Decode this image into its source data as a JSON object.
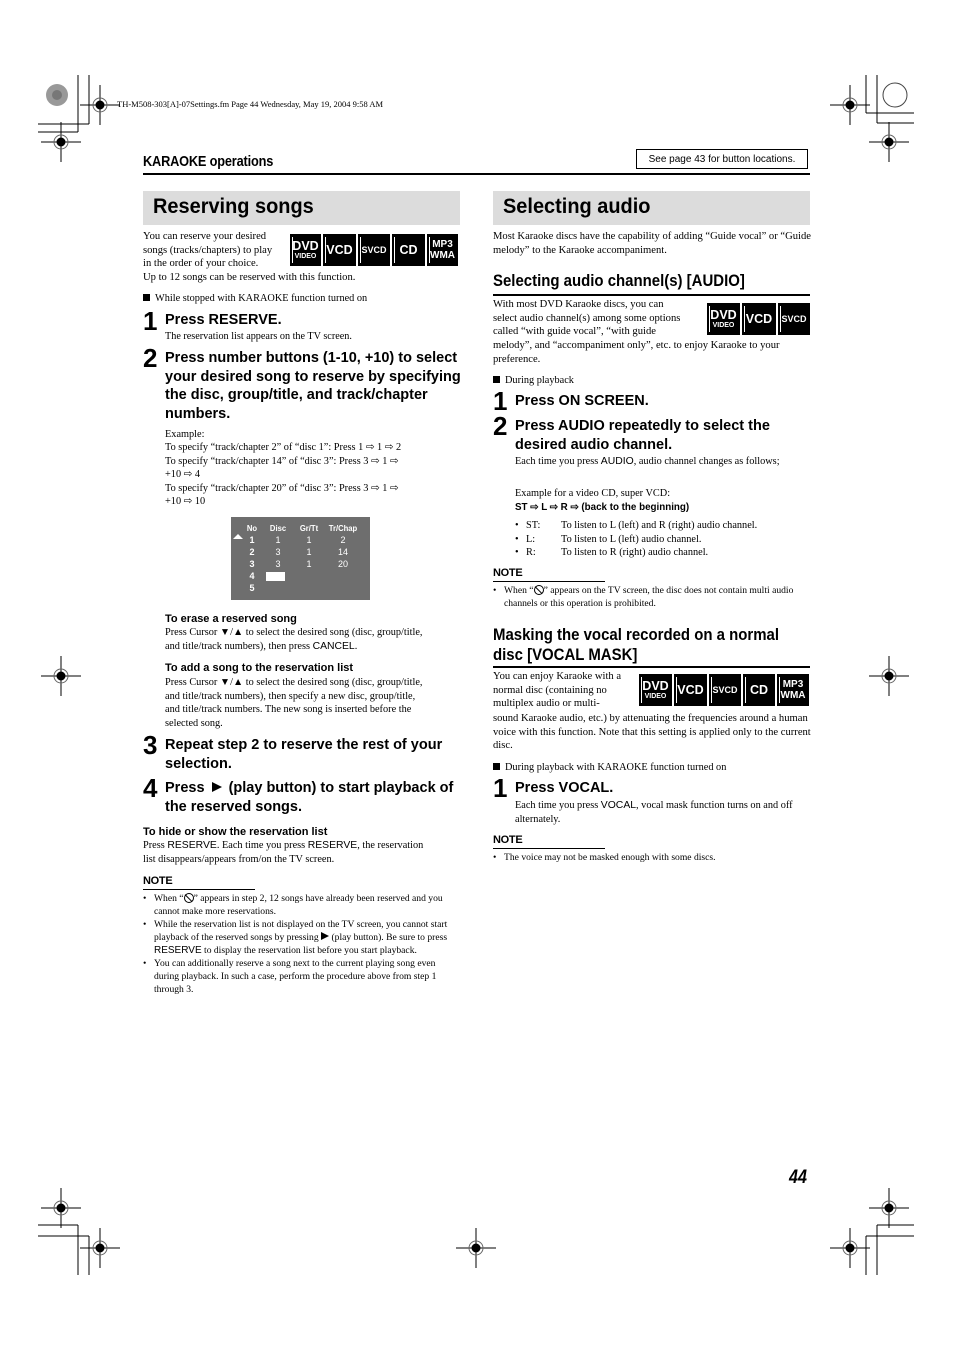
{
  "file_info": "TH-M508-303[A]-07Settings.fm  Page 44  Wednesday, May 19, 2004  9:58 AM",
  "header": {
    "section_label": "KARAOKE operations",
    "see_page_note": "See page 43 for button locations."
  },
  "page_number": "44",
  "left": {
    "title": "Reserving songs",
    "intro_lines": [
      "You can reserve your desired",
      "songs (tracks/chapters) to play",
      "in the order of your choice."
    ],
    "intro_tail": "Up to 12 songs can be reserved with this function.",
    "badges": [
      {
        "line1": "DVD",
        "line2": "VIDEO",
        "icon": "dvd-video-icon"
      },
      {
        "line1": "VCD",
        "icon": "vcd-icon"
      },
      {
        "line1": "SVCD",
        "icon": "svcd-icon"
      },
      {
        "line1": "CD",
        "icon": "cd-icon"
      },
      {
        "line1": "MP3",
        "line2": "WMA",
        "icon": "mp3-wma-icon"
      }
    ],
    "condition": "While stopped with KARAOKE function turned on",
    "steps": [
      {
        "num": "1",
        "text": "Press RESERVE.",
        "desc": "The reservation list appears on the TV screen."
      },
      {
        "num": "2",
        "text": "Press number buttons (1-10, +10) to select your desired song to reserve by specifying the disc, group/title, and track/chapter numbers."
      },
      {
        "num": "3",
        "text": "Repeat step 2 to reserve the rest of your selection."
      },
      {
        "num": "4",
        "text_before": "Press",
        "text_after": "(play button) to start playback of the reserved songs."
      }
    ],
    "example": {
      "label": "Example:",
      "lines": [
        "To specify “track/chapter 2” of “disc 1”: Press 1 ⇨ 1 ⇨ 2",
        "To specify “track/chapter 14” of “disc 3”: Press 3 ⇨ 1 ⇨",
        "+10 ⇨ 4",
        "To specify “track/chapter 20” of “disc 3”: Press 3 ⇨ 1 ⇨",
        "+10 ⇨ 10"
      ]
    },
    "reservation_screen": {
      "columns": [
        "No",
        "Disc",
        "Gr/Tt",
        "Tr/Chap"
      ],
      "rows": [
        [
          "1",
          "1",
          "1",
          "2"
        ],
        [
          "2",
          "3",
          "1",
          "14"
        ],
        [
          "3",
          "3",
          "1",
          "20"
        ],
        [
          "4",
          "",
          "",
          ""
        ],
        [
          "5",
          "",
          "",
          ""
        ]
      ]
    },
    "erase": {
      "title": "To erase a reserved song",
      "text_lines": [
        "Press Cursor ▼/▲ to select the desired song (disc, group/title,",
        "and title/track numbers), then press"
      ],
      "key": "CANCEL",
      "end": "."
    },
    "add": {
      "title": "To add a song to the reservation list",
      "text_lines": [
        "Press Cursor ▼/▲ to select the desired song (disc, group/title,",
        "and title/track numbers), then specify a new disc, group/title,",
        "and title/track numbers. The new song is inserted before the",
        "selected song."
      ]
    },
    "hide_show": {
      "title": "To hide or show the reservation list",
      "line1_a": "Press ",
      "key": "RESERVE",
      "line1_b": ". Each time you press ",
      "line1_c": ", the reservation",
      "line2": "list disappears/appears from/on the TV screen."
    },
    "note": {
      "title": "NOTE",
      "items": [
        {
          "before": "When “",
          "after": "” appears in step 2, 12 songs have already been reserved and you cannot make more reservations."
        },
        {
          "a": "While the reservation list is not displayed on the TV screen, you cannot start playback of the reserved songs by pressing ",
          "b": " (play button). Be sure to press ",
          "key": "RESERVE",
          "c": " to display the reservation list before you start playback."
        },
        {
          "text": "You can additionally reserve a song next to the current playing song even during playback. In such a case, perform the procedure above from step 1 through 3."
        }
      ]
    }
  },
  "right": {
    "title": "Selecting audio",
    "intro": "Most Karaoke discs have the capability of adding “Guide vocal” or “Guide melody” to the Karaoke accompaniment.",
    "audio_channel": {
      "heading": "Selecting audio channel(s) [AUDIO]",
      "intro_lines": [
        "With most DVD Karaoke discs, you can",
        "select audio channel(s) among some options",
        "called “with guide vocal”, “with guide"
      ],
      "intro_tail": "melody”, and “accompaniment only”, etc. to enjoy Karaoke to your preference.",
      "badges": [
        {
          "line1": "DVD",
          "line2": "VIDEO",
          "icon": "dvd-video-icon"
        },
        {
          "line1": "VCD",
          "icon": "vcd-icon"
        },
        {
          "line1": "SVCD",
          "icon": "svcd-icon"
        }
      ],
      "condition": "During playback",
      "steps": [
        {
          "num": "1",
          "text": "Press ON SCREEN."
        },
        {
          "num": "2",
          "text": "Press AUDIO repeatedly to select the desired audio channel."
        }
      ],
      "each_time_a": "Each time you press ",
      "each_time_key": "AUDIO",
      "each_time_b": ", audio channel changes as follows;",
      "example_label": "Example for a video CD, super VCD:",
      "sequence": [
        "ST",
        "L",
        "R",
        "(back to the beginning)"
      ],
      "channels": [
        {
          "key": "ST:",
          "desc": "To listen to L (left) and R (right) audio channel."
        },
        {
          "key": "L:",
          "desc": "To listen to L (left) audio channel."
        },
        {
          "key": "R:",
          "desc": "To listen to R (right) audio channel."
        }
      ],
      "note": {
        "title": "NOTE",
        "before": "When “",
        "after": "” appears on the TV screen, the disc does not contain multi audio channels or this operation is prohibited."
      }
    },
    "vocal_mask": {
      "heading_line1": "Masking the vocal recorded on a normal",
      "heading_line2": "disc [VOCAL MASK]",
      "intro_lines": [
        "You can enjoy Karaoke with a",
        "normal disc (containing no",
        "multiplex audio or multi-"
      ],
      "intro_tail": "sound Karaoke audio, etc.) by attenuating the frequencies around a human voice with this function. Note that this setting is applied only to the current disc.",
      "badges": [
        {
          "line1": "DVD",
          "line2": "VIDEO",
          "icon": "dvd-video-icon"
        },
        {
          "line1": "VCD",
          "icon": "vcd-icon"
        },
        {
          "line1": "SVCD",
          "icon": "svcd-icon"
        },
        {
          "line1": "CD",
          "icon": "cd-icon"
        },
        {
          "line1": "MP3",
          "line2": "WMA",
          "icon": "mp3-wma-icon"
        }
      ],
      "condition": "During playback with KARAOKE function turned on",
      "step": {
        "num": "1",
        "text": "Press VOCAL."
      },
      "desc_a": "Each time you press ",
      "desc_key": "VOCAL",
      "desc_b": ", vocal mask function turns on and off alternately.",
      "note": {
        "title": "NOTE",
        "items": [
          "The voice may not be masked enough with some discs."
        ]
      }
    }
  }
}
